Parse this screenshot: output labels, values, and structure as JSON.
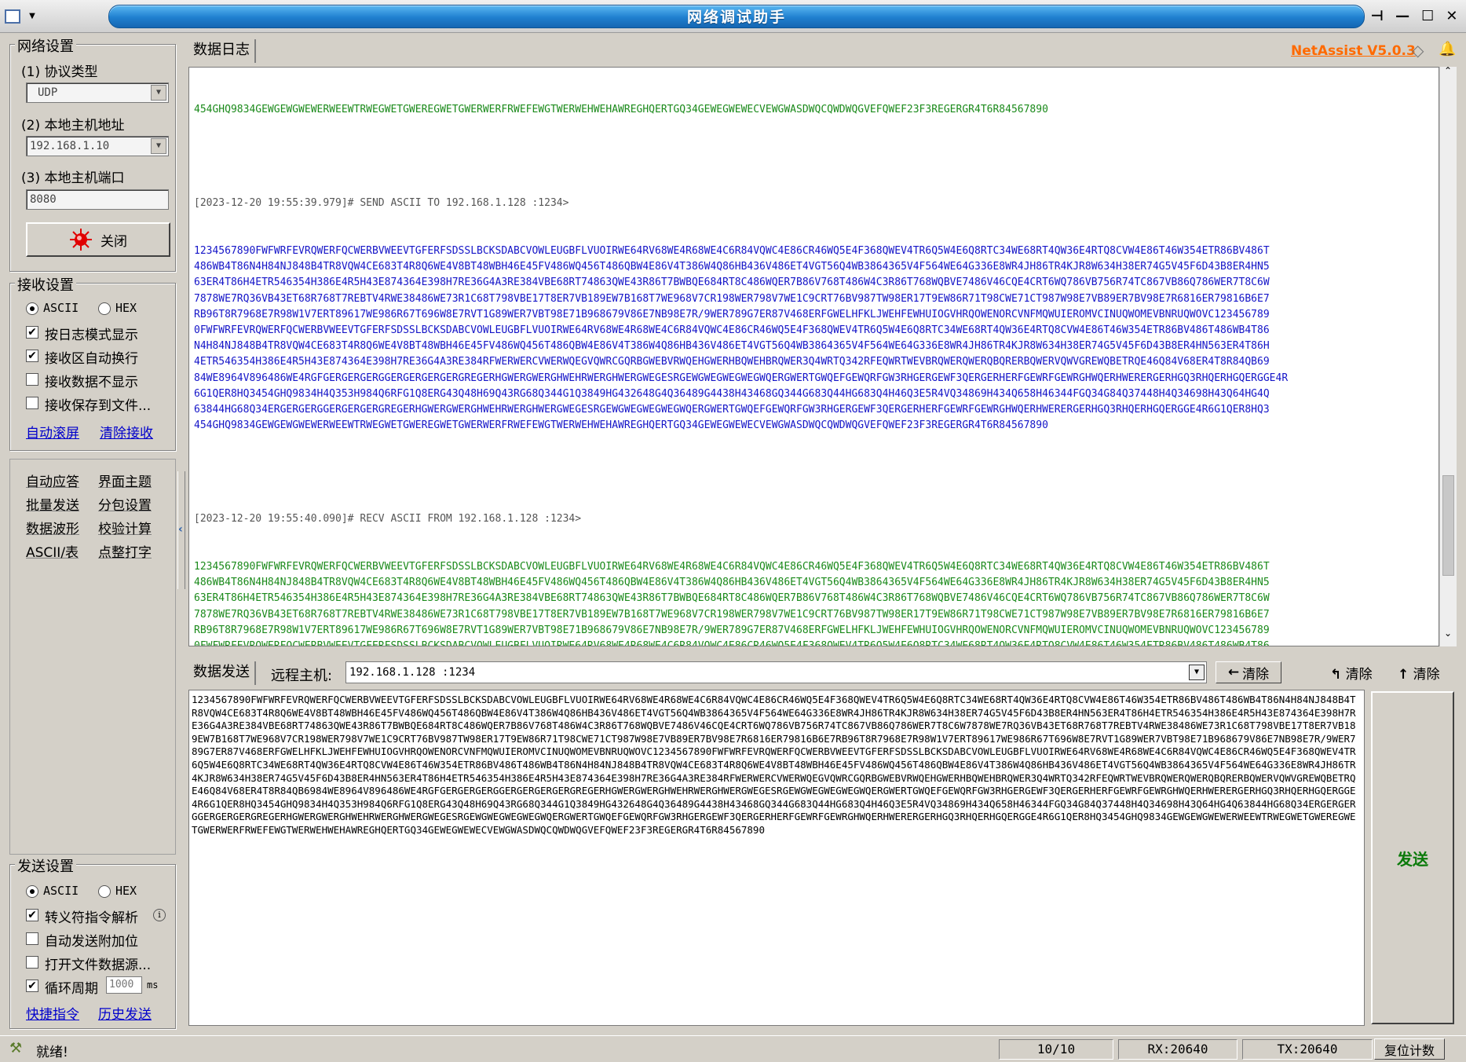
{
  "window": {
    "title": "网络调试助手",
    "sysmenu_glyph": "▼"
  },
  "network": {
    "group_title": "网络设置",
    "protocol_label": "(1) 协议类型",
    "protocol_value": "UDP",
    "host_label": "(2) 本地主机地址",
    "host_value": "192.168.1.10",
    "port_label": "(3) 本地主机端口",
    "port_value": "8080",
    "close_button": "关闭"
  },
  "receive": {
    "group_title": "接收设置",
    "ascii": "ASCII",
    "hex": "HEX",
    "mode": "ASCII",
    "opt_log_mode": "按日志模式显示",
    "opt_log_mode_checked": true,
    "opt_auto_wrap": "接收区自动换行",
    "opt_auto_wrap_checked": true,
    "opt_hide_data": "接收数据不显示",
    "opt_hide_data_checked": false,
    "opt_save_file": "接收保存到文件...",
    "opt_save_file_checked": false,
    "link_autoscroll": "自动滚屏",
    "link_clear": "清除接收"
  },
  "tools": {
    "auto_reply": "自动应答",
    "theme": "界面主题",
    "batch_send": "批量发送",
    "packet_settings": "分包设置",
    "waveform": "数据波形",
    "checksum": "校验计算",
    "ascii_table": "ASCII/表",
    "dot_matrix": "点整打字"
  },
  "send_settings": {
    "group_title": "发送设置",
    "ascii": "ASCII",
    "hex": "HEX",
    "opt_escape": "转义符指令解析",
    "opt_escape_checked": true,
    "opt_append_bits": "自动发送附加位",
    "opt_append_bits_checked": false,
    "opt_file_source": "打开文件数据源...",
    "opt_file_source_checked": false,
    "opt_cycle": "循环周期",
    "opt_cycle_checked": true,
    "cycle_value": "1000",
    "cycle_unit": "ms",
    "link_shortcuts": "快捷指令",
    "link_history": "历史发送"
  },
  "log": {
    "tab": "数据日志",
    "brand": "NetAssist V5.0.3",
    "top_line": "454GHQ9834GEWGEWGWEWERWEEWTRWEGWETGWEREGWETGWERWERFRWEFEWGTWERWEHWEHAWREGHQERTGQ34GEWEGWEWECVEWGWASDWQCQWDWQGVEFQWEF23F3REGERGR4T6R84567890",
    "send_header": "[2023-12-20 19:55:39.979]# SEND ASCII TO 192.168.1.128 :1234>",
    "recv_header": "[2023-12-20 19:55:40.090]# RECV ASCII FROM 192.168.1.128 :1234>",
    "payload_lines": [
      "1234567890FWFWRFEVRQWERFQCWERBVWEEVTGFERFSDSSLBCKSDABCVOWLEUGBFLVUOIRWE64RV68WE4R68WE4C6R84VQWC4E86CR46WQ5E4F368QWEV4TR6Q5W4E6Q8RTC34WE68RT4QW36E4RTQ8CVW4E86T46W354ETR86BV486T",
      "486WB4T86N4H84NJ848B4TR8VQW4CE683T4R8Q6WE4V8BT48WBH46E45FV486WQ456T486QBW4E86V4T386W4Q86HB436V486ET4VGT56Q4WB3864365V4F564WE64G336E8WR4JH86TR4KJR8W634H38ER74G5V45F6D43B8ER4HN5",
      "63ER4T86H4ETR546354H386E4R5H43E874364E398H7RE36G4A3RE384VBE68RT74863QWE43R86T7BWBQE684RT8C486WQER7B86V768T486W4C3R86T768WQBVE7486V46CQE4CRT6WQ786VB756R74TC867VB86Q786WER7T8C6W",
      "7878WE7RQ36VB43ET68R768T7REBTV4RWE38486WE73R1C68T798VBE17T8ER7VB189EW7B168T7WE968V7CR198WER798V7WE1C9CRT76BV987TW98ER17T9EW86R71T98CWE71CT987W98E7VB89ER7BV98E7R6816ER79816B6E7",
      "RB96T8R7968E7R98W1V7ERT89617WE986R67T696W8E7RVT1G89WER7VBT98E71B968679V86E7NB98E7R/9WER789G7ER87V468ERFGWELHFKLJWEHFEWHUIOGVHRQOWENORCVNFMQWUIEROMVCINUQWOMEVBNRUQWOVC123456789",
      "0FWFWRFEVRQWERFQCWERBVWEEVTGFERFSDSSLBCKSDABCVOWLEUGBFLVUOIRWE64RV68WE4R68WE4C6R84VQWC4E86CR46WQ5E4F368QWEV4TR6Q5W4E6Q8RTC34WE68RT4QW36E4RTQ8CVW4E86T46W354ETR86BV486T486WB4T86",
      "N4H84NJ848B4TR8VQW4CE683T4R8Q6WE4V8BT48WBH46E45FV486WQ456T486QBW4E86V4T386W4Q86HB436V486ET4VGT56Q4WB3864365V4F564WE64G336E8WR4JH86TR4KJR8W634H38ER74G5V45F6D43B8ER4HN563ER4T86H",
      "4ETR546354H386E4R5H43E874364E398H7RE36G4A3RE384RFWERWERCVWERWQEGVQWRCGQRBGWEBVRWQEHGWERHBQWEHBRQWER3Q4WRTQ342RFEQWRTWEVBRQWERQWERQBQRERBQWERVQWVGREWQBETRQE46Q84V68ER4T8R84QB69",
      "84WE8964V896486WE4RGFGERGERGERGGERGERGERGERGREGERHGWERGWERGHWEHRWERGHWERGWEGESRGEWGWEGWEGWEGWQERGWERTGWQEFGEWQRFGW3RHGERGEWF3QERGERHERFGEWRFGEWRGHWQERHWERERGERHGQ3RHQERHGQERGGE4R",
      "6G1QER8HQ3454GHQ9834H4Q353H984Q6RFG1Q8ERG43Q48H69Q43RG68Q344G1Q3849HG432648G4Q36489G4438H43468GQ344G683Q44HG683Q4H46Q3E5R4VQ34869H434Q658H46344FGQ34G84Q37448H4Q34698H43Q64HG4Q",
      "63844HG68Q34ERGERGERGGERGERGERGREGERHGWERGWERGHWEHRWERGHWERGWEGESRGEWGWEGWEGWEGWQERGWERTGWQEFGEWQRFGW3RHGERGEWF3QERGERHERFGEWRFGEWRGHWQERHWERERGERHGQ3RHQERHGQERGGE4R6G1QER8HQ3",
      "454GHQ9834GEWGEWGWEWERWEEWTRWEGWETGWEREGWETGWERWERFRWEFEWGTWERWEHWEHAWREGHQERTGQ34GEWEGWEWECVEWGWASDWQCQWDWQGVEFQWEF23F3REGERGR4T6R84567890"
    ]
  },
  "send": {
    "tab": "数据发送",
    "remote_label": "远程主机:",
    "remote_value": "192.168.1.128 :1234",
    "clear1": "清除",
    "clear2": "清除",
    "clear3": "清除",
    "send_button": "发送",
    "content": "1234567890FWFWRFEVRQWERFQCWERBVWEEVTGFERFSDSSLBCKSDABCVOWLEUGBFLVUOIRWE64RV68WE4R68WE4C6R84VQWC4E86CR46WQ5E4F368QWEV4TR6Q5W4E6Q8RTC34WE68RT4QW36E4RTQ8CVW4E86T46W354ETR86BV486T486WB4T86N4H84NJ848B4TR8VQW4CE683T4R8Q6WE4V8BT48WBH46E45FV486WQ456T486QBW4E86V4T386W4Q86HB436V486ET4VGT56Q4WB3864365V4F564WE64G336E8WR4JH86TR4KJR8W634H38ER74G5V45F6D43B8ER4HN563ER4T86H4ETR546354H386E4R5H43E874364E398H7RE36G4A3RE384VBE68RT74863QWE43R86T7BWBQE684RT8C486WQER7B86V768T486W4C3R86T768WQBVE7486V46CQE4CRT6WQ786VB756R74TC867VB86Q786WER7T8C6W7878WE7RQ36VB43ET68R768T7REBTV4RWE38486WE73R1C68T798VBE17T8ER7VB189EW7B168T7WE968V7CR198WER798V7WE1C9CRT76BV987TW98ER17T9EW86R71T98CWE71CT987W98E7VB89ER7BV98E7R6816ER79816B6E7RB96T8R7968E7R98W1V7ERT89617WE986R67T696W8E7RVT1G89WER7VBT98E71B968679V86E7NB98E7R/9WER789G7ER87V468ERFGWELHFKLJWEHFEWHUIOGVHRQOWENORCVNFMQWUIEROMVCINUQWOMEVBNRUQWOVC1234567890FWFWRFEVRQWERFQCWERBVWEEVTGFERFSDSSLBCKSDABCVOWLEUGBFLVUOIRWE64RV68WE4R68WE4C6R84VQWC4E86CR46WQ5E4F368QWEV4TR6Q5W4E6Q8RTC34WE68RT4QW36E4RTQ8CVW4E86T46W354ETR86BV486T486WB4T86N4H84NJ848B4TR8VQW4CE683T4R8Q6WE4V8BT48WBH46E45FV486WQ456T486QBW4E86V4T386W4Q86HB436V486ET4VGT56Q4WB3864365V4F564WE64G336E8WR4JH86TR4KJR8W634H38ER74G5V45F6D43B8ER4HN563ER4T86H4ETR546354H386E4R5H43E874364E398H7RE36G4A3RE384RFWERWERCVWERWQEGVQWRCGQRBGWEBVRWQEHGWERHBQWEHBRQWER3Q4WRTQ342RFEQWRTWEVBRQWERQWERQBQRERBQWERVQWVGREWQBETRQE46Q84V68ER4T8R84QB6984WE8964V896486WE4RGFGERGERGERGGERGERGERGERGREGERHGWERGWERGHWEHRWERGHWERGWEGESRGEWGWEGWEGWEGWQERGWERTGWQEFGEWQRFGW3RHGERGEWF3QERGERHERFGEWRFGEWRGHWQERHWERERGERHGQ3RHQERHGQERGGE4R6G1QER8HQ3454GHQ9834H4Q353H984Q6RFG1Q8ERG43Q48H69Q43RG68Q344G1Q3849HG432648G4Q36489G4438H43468GQ344G683Q44HG683Q4H46Q3E5R4VQ34869H434Q658H46344FGQ34G84Q37448H4Q34698H43Q64HG4Q63844HG68Q34ERGERGERGGERGERGERGREGERHGWERGWERGHWEHRWERGHWERGWEGESRGEWGWEGWEGWEGWQERGWERTGWQEFGEWQRFGW3RHGERGEWF3QERGERHERFGEWRFGEWRGHWQERHWERERGERHGQ3RHQERHGQERGGE4R6G1QER8HQ3454GHQ9834GEWGEWGWEWERWEEWTRWEGWETGWEREGWETGWERWERFRWEFEWGTWERWEHWEHAWREGHQERTGQ34GEWEGWEWECVEWGWASDWQCQWDWQGVEFQWEF23F3REGERGR4T6R84567890"
  },
  "status": {
    "ready": "就绪!",
    "count": "10/10",
    "rx": "RX:20640",
    "tx": "TX:20640",
    "reset": "复位计数"
  },
  "colors": {
    "title_blue": "#1f7fcf",
    "brand": "#ff6a00",
    "send_green": "#0a7a0a",
    "log_blue": "#1515c8",
    "log_green": "#1b8a1b"
  },
  "icons": {
    "close_button_icon": "red-sunburst-icon",
    "status_icon": "wrench-icon"
  }
}
